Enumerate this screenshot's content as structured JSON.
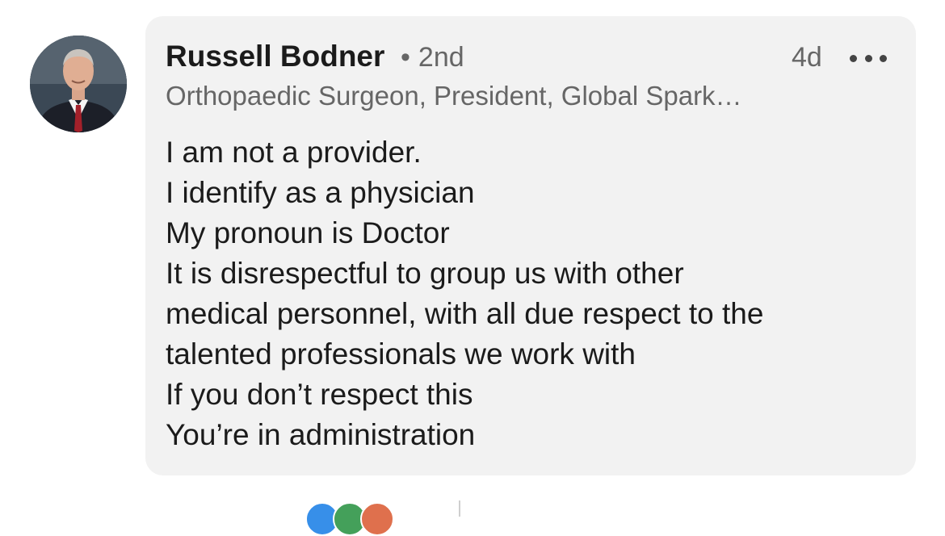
{
  "comment": {
    "author_name": "Russell Bodner",
    "connection_degree": "2nd",
    "time_ago": "4d",
    "headline": "Orthopaedic Surgeon, President, Global Spark…",
    "body_lines": [
      "I am not a provider.",
      "I identify as a physician",
      "My pronoun is Doctor",
      "It is disrespectful to group us with other",
      "medical personnel, with all due respect to the",
      "talented professionals we work with",
      "If you don’t respect this",
      "You’re in administration"
    ]
  },
  "colors": {
    "bubble_background": "#f2f2f2",
    "primary_text": "#1b1b1b",
    "secondary_text": "#666666",
    "reaction_like": "#378fe9",
    "reaction_celebrate": "#44a05a",
    "reaction_love": "#df704d"
  },
  "icons": {
    "more": "more-horizontal-icon",
    "reactions": [
      "like-reaction-icon",
      "celebrate-reaction-icon",
      "love-reaction-icon"
    ]
  }
}
